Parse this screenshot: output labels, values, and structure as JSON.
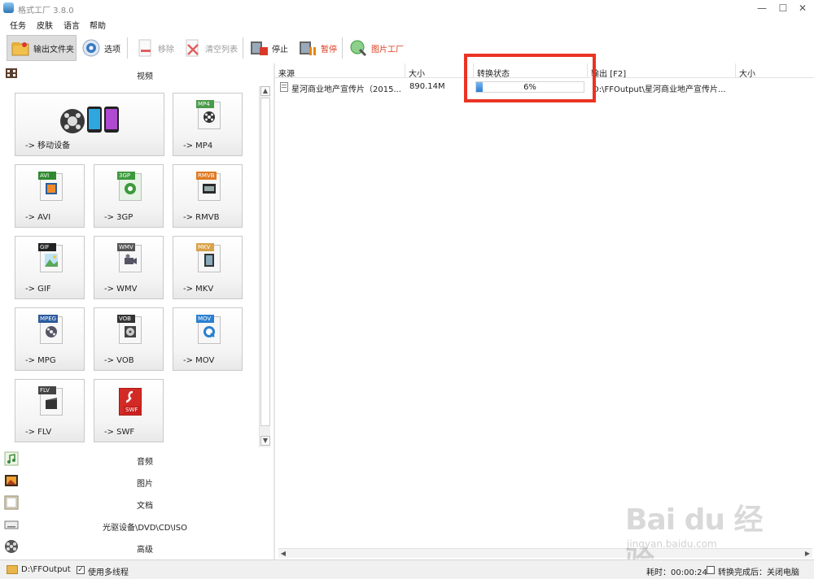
{
  "window": {
    "title": "格式工厂 3.8.0",
    "minimize": "—",
    "maximize": "☐",
    "close": "✕"
  },
  "menu": [
    "任务",
    "皮肤",
    "语言",
    "帮助"
  ],
  "toolbar": {
    "output_folder": "输出文件夹",
    "options": "选项",
    "remove": "移除",
    "clear_list": "清空列表",
    "stop": "停止",
    "pause": "暂停",
    "picture_factory": "图片工厂"
  },
  "left": {
    "video": "视频",
    "tiles": [
      {
        "label": "-> 移动设备",
        "tag": ""
      },
      {
        "label": "-> MP4",
        "tag": "MP4",
        "color": "#4a9a4a"
      },
      {
        "label": "-> AVI",
        "tag": "AVI",
        "color": "#2f8a2f"
      },
      {
        "label": "-> 3GP",
        "tag": "3GP",
        "color": "#3c9a3c"
      },
      {
        "label": "-> RMVB",
        "tag": "RMVB",
        "color": "#e07a22"
      },
      {
        "label": "-> GIF",
        "tag": "GIF",
        "color": "#222222"
      },
      {
        "label": "-> WMV",
        "tag": "WMV",
        "color": "#555555"
      },
      {
        "label": "-> MKV",
        "tag": "MKV",
        "color": "#d8a24a"
      },
      {
        "label": "-> MPG",
        "tag": "MPEG",
        "color": "#2b5a9e"
      },
      {
        "label": "-> VOB",
        "tag": "VOB",
        "color": "#333333"
      },
      {
        "label": "-> MOV",
        "tag": "MOV",
        "color": "#2a7fd0"
      },
      {
        "label": "-> FLV",
        "tag": "FLV",
        "color": "#444444"
      },
      {
        "label": "-> SWF",
        "tag": "SWF",
        "color": "#c8201e"
      }
    ],
    "categories": [
      "音频",
      "图片",
      "文档",
      "光驱设备\\DVD\\CD\\ISO",
      "高级"
    ]
  },
  "table": {
    "headers": [
      "来源",
      "大小",
      "转换状态",
      "输出 [F2]",
      "大小"
    ],
    "row": {
      "source": "星河商业地产宣传片（2015...",
      "size": "890.14M",
      "progress_label": "6%",
      "progress": 0.06,
      "output": "D:\\FFOutput\\星河商业地产宣传片..."
    }
  },
  "status": {
    "output_path": "D:\\FFOutput",
    "multithread": "使用多线程",
    "elapsed": "耗时：00:00:24",
    "after_done": "转换完成后：关闭电脑"
  },
  "watermark": {
    "main": "Bai du 经验",
    "sub": "jingyan.baidu.com"
  },
  "colors": {
    "highlight": "#ea3323",
    "progress": "#2d7fd3"
  }
}
